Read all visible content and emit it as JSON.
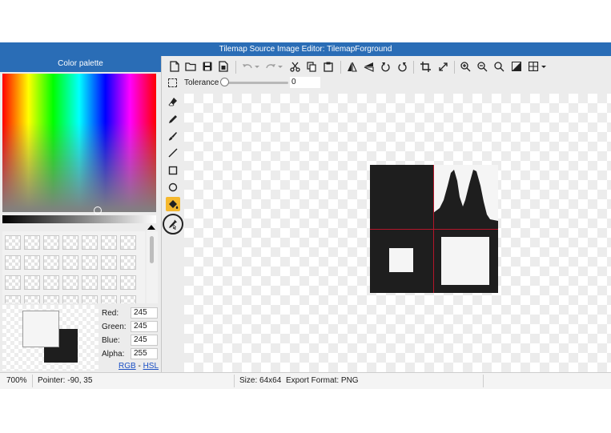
{
  "window": {
    "title": "Tilemap Source Image Editor: TilemapForground"
  },
  "palette": {
    "title": "Color palette",
    "rgb": [
      {
        "label": "Red:",
        "value": "245"
      },
      {
        "label": "Green:",
        "value": "245"
      },
      {
        "label": "Blue:",
        "value": "245"
      },
      {
        "label": "Alpha:",
        "value": "255"
      }
    ],
    "mode_rgb": "RGB",
    "mode_sep": "-",
    "mode_hsl": "HSL",
    "primary_color": "#f5f5f5",
    "secondary_color": "#1e1e1e"
  },
  "toolbar": {
    "icons": [
      "new-file-icon",
      "open-folder-icon",
      "save-icon",
      "save-as-icon",
      "undo-icon",
      "redo-icon",
      "cut-icon",
      "copy-icon",
      "paste-icon",
      "flip-horizontal-icon",
      "flip-vertical-icon",
      "rotate-left-icon",
      "rotate-right-icon",
      "crop-icon",
      "resize-icon",
      "zoom-in-icon",
      "zoom-out-icon",
      "zoom-fit-icon",
      "contrast-icon",
      "grid-icon"
    ]
  },
  "options": {
    "tolerance_label": "Tolerance",
    "tolerance_value": "0",
    "tolerance_fraction": 0
  },
  "tools": [
    "eraser-icon",
    "pencil-icon",
    "brush-icon",
    "line-icon",
    "rectangle-icon",
    "ellipse-icon",
    "fill-bucket-icon",
    "eyedropper-icon"
  ],
  "active_tool": "fill-bucket-icon",
  "status": {
    "zoom": "700%",
    "pointer": "Pointer: -90, 35",
    "size": "Size: 64x64",
    "export": "Export Format: PNG"
  }
}
